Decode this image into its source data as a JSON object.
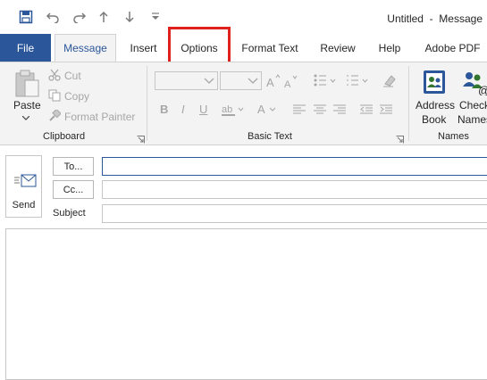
{
  "window": {
    "title": "Untitled  -  Message"
  },
  "quick_access": {
    "icons": [
      "save-icon",
      "undo-icon",
      "redo-icon",
      "up-arrow-icon",
      "down-arrow-icon",
      "customize-toolbar-icon"
    ]
  },
  "tabs": [
    {
      "label": "File"
    },
    {
      "label": "Message"
    },
    {
      "label": "Insert"
    },
    {
      "label": "Options"
    },
    {
      "label": "Format Text"
    },
    {
      "label": "Review"
    },
    {
      "label": "Help"
    },
    {
      "label": "Adobe PDF"
    }
  ],
  "active_tab": "Message",
  "highlighted_tab": "Options",
  "highlight_color": "#e0201c",
  "accent_color": "#2b579a",
  "ribbon": {
    "clipboard": {
      "paste_label": "Paste",
      "cut_label": "Cut",
      "copy_label": "Copy",
      "format_painter_label": "Format Painter",
      "group_label": "Clipboard"
    },
    "basic_text": {
      "font_name_value": "",
      "font_size_value": "",
      "bold": "B",
      "italic": "I",
      "underline": "U",
      "font_color": "A",
      "group_label": "Basic Text"
    },
    "names": {
      "address_book_label_1": "Address",
      "address_book_label_2": "Book",
      "check_names_label_1": "Check",
      "check_names_label_2": "Names",
      "group_label": "Names"
    }
  },
  "message": {
    "send_label": "Send",
    "to_label": "To...",
    "cc_label": "Cc...",
    "subject_label": "Subject",
    "to_value": "",
    "cc_value": "",
    "subject_value": "",
    "body_value": ""
  }
}
